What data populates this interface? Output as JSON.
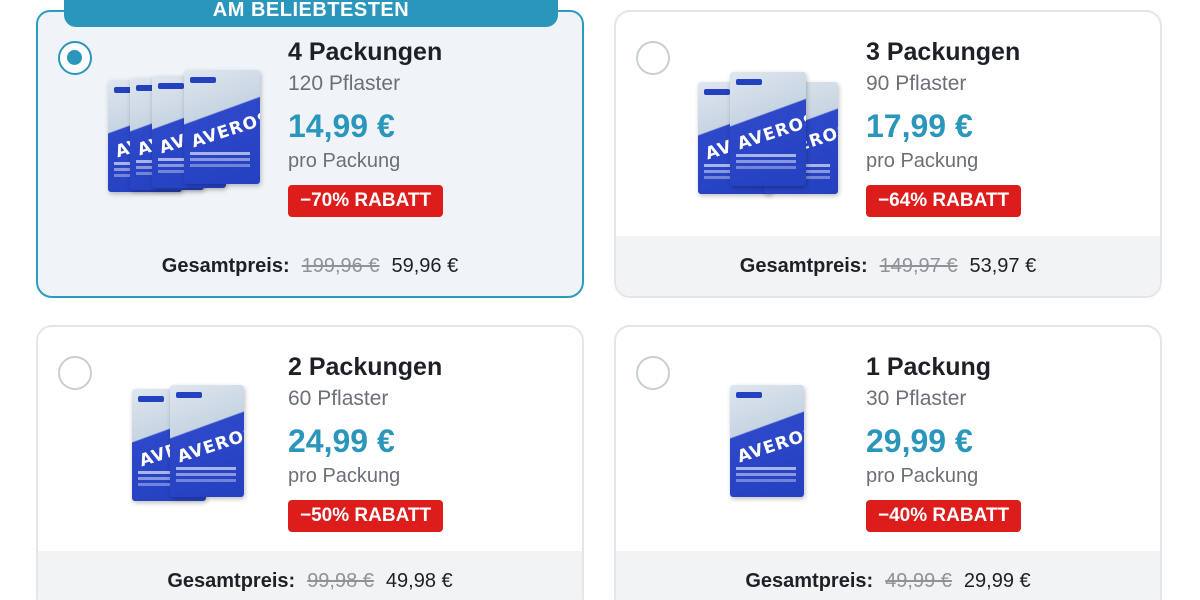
{
  "badge": "AM BELIEBTESTEN",
  "brand": "AVEROS",
  "total_label": "Gesamtpreis:",
  "offers": [
    {
      "title": "4 Packungen",
      "subtitle": "120 Pflaster",
      "price": "14,99 €",
      "per": "pro Packung",
      "discount": "−70% RABATT",
      "old_total": "199,96 €",
      "new_total": "59,96 €",
      "selected": true
    },
    {
      "title": "3 Packungen",
      "subtitle": "90 Pflaster",
      "price": "17,99 €",
      "per": "pro Packung",
      "discount": "−64% RABATT",
      "old_total": "149,97 €",
      "new_total": "53,97 €",
      "selected": false
    },
    {
      "title": "2 Packungen",
      "subtitle": "60 Pflaster",
      "price": "24,99 €",
      "per": "pro Packung",
      "discount": "−50% RABATT",
      "old_total": "99,98 €",
      "new_total": "49,98 €",
      "selected": false
    },
    {
      "title": "1 Packung",
      "subtitle": "30 Pflaster",
      "price": "29,99 €",
      "per": "pro Packung",
      "discount": "−40% RABATT",
      "old_total": "49,99 €",
      "new_total": "29,99 €",
      "selected": false
    }
  ],
  "colors": {
    "accent": "#2b96bb",
    "discount": "#dd1c1c",
    "pack_blue": "#2441c0"
  }
}
